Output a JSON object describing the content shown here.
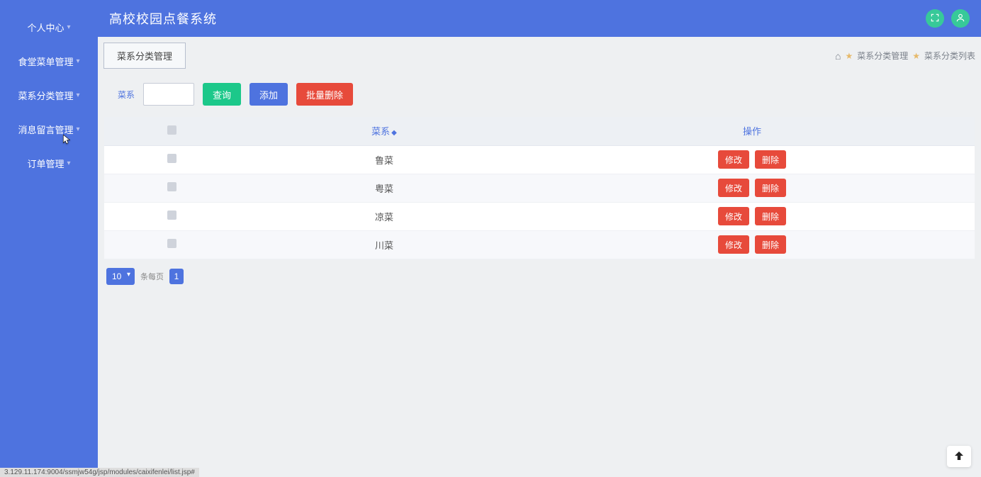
{
  "app_title": "高校校园点餐系统",
  "sidebar": {
    "items": [
      {
        "label": "个人中心"
      },
      {
        "label": "食堂菜单管理"
      },
      {
        "label": "菜系分类管理"
      },
      {
        "label": "消息留言管理"
      },
      {
        "label": "订单管理"
      }
    ]
  },
  "page_tab": "菜系分类管理",
  "breadcrumb": {
    "a": "菜系分类管理",
    "b": "菜系分类列表"
  },
  "filter": {
    "label": "菜系",
    "input_value": "",
    "search_btn": "查询",
    "add_btn": "添加",
    "batch_delete_btn": "批量删除"
  },
  "table": {
    "col_category": "菜系",
    "col_action": "操作",
    "edit_btn": "修改",
    "delete_btn": "删除",
    "rows": [
      {
        "name": "鲁菜"
      },
      {
        "name": "粤菜"
      },
      {
        "name": "凉菜"
      },
      {
        "name": "川菜"
      }
    ]
  },
  "pager": {
    "per_page_value": "10",
    "per_page_label": "条每页",
    "current_page": "1"
  },
  "status_hint": "3.129.11.174:9004/ssmjw54g/jsp/modules/caixifenlei/list.jsp#"
}
